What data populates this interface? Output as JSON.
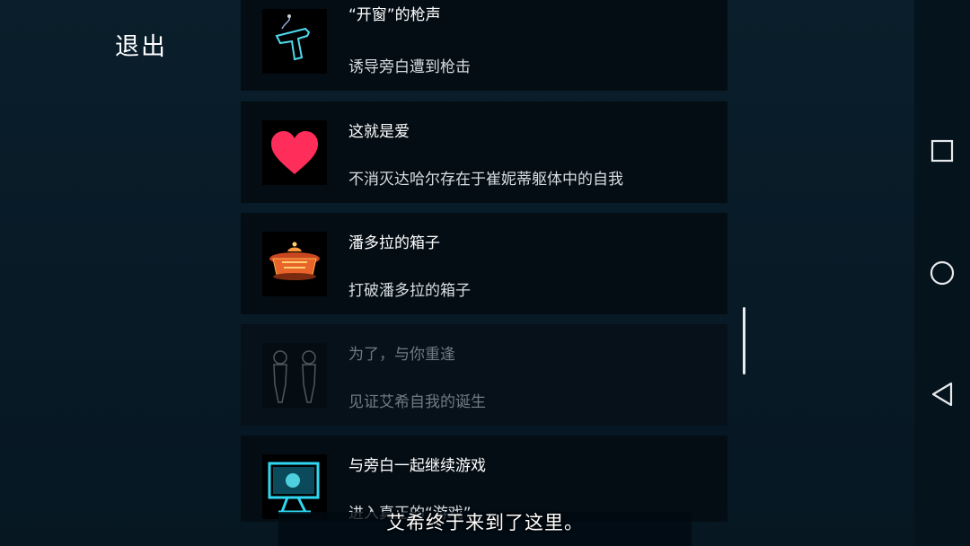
{
  "exit_label": "退出",
  "achievements": [
    {
      "title": "“开窗”的枪声",
      "desc": "诱导旁白遭到枪击",
      "icon": "pistol-icon",
      "locked": false
    },
    {
      "title": "这就是爱",
      "desc": "不消灭达哈尔存在于崔妮蒂躯体中的自我",
      "icon": "heart-icon",
      "locked": false
    },
    {
      "title": "潘多拉的箱子",
      "desc": "打破潘多拉的箱子",
      "icon": "pandora-box-icon",
      "locked": false
    },
    {
      "title": "为了，与你重逢",
      "desc": "见证艾希自我的诞生",
      "icon": "twin-figures-icon",
      "locked": true
    },
    {
      "title": "与旁白一起继续游戏",
      "desc": "进入真正的“游戏”",
      "icon": "monitor-icon",
      "locked": false
    }
  ],
  "subtitle": "艾希终于来到了这里。",
  "colors": {
    "accent_heart": "#ff2d5a",
    "accent_box": "#e8642a",
    "accent_cyan": "#2fd8f2"
  }
}
